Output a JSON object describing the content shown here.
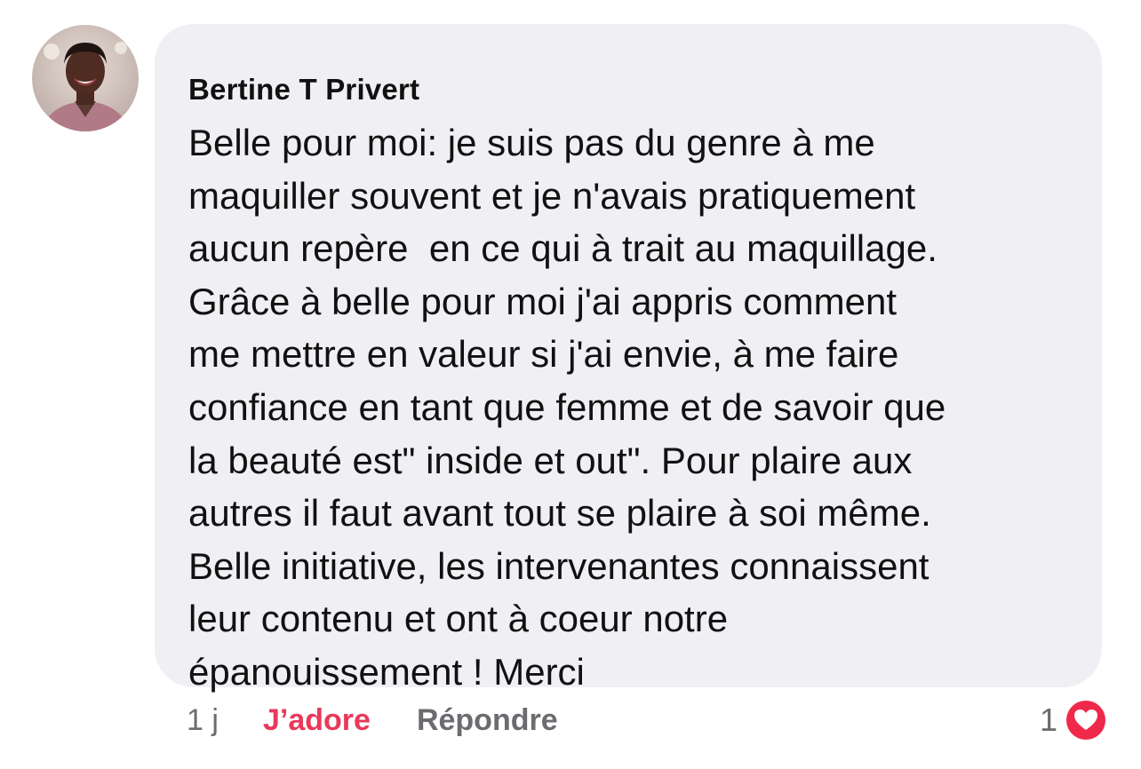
{
  "comment": {
    "author": "Bertine T Privert",
    "lines": [
      "Belle pour moi: je suis pas du genre à me",
      "maquiller souvent et je n'avais pratiquement",
      "aucun repère  en ce qui à trait au maquillage.",
      "Grâce à belle pour moi j'ai appris comment",
      "me mettre en valeur si j'ai envie, à me faire",
      "confiance en tant que femme et de savoir que",
      "la beauté est\" inside et out\". Pour plaire aux",
      "autres il faut avant tout se plaire à soi même.",
      "Belle initiative, les intervenantes connaissent",
      "leur contenu et ont à coeur notre",
      "épanouissement ! Merci"
    ]
  },
  "actions": {
    "time": "1 j",
    "love_label": "J’adore",
    "reply_label": "Répondre"
  },
  "reactions": {
    "count": "1",
    "icon": "heart-icon",
    "color": "#f0284a"
  },
  "colors": {
    "bubble": "#f0f0f4",
    "love": "#e9395a",
    "muted": "#6b6b70"
  }
}
